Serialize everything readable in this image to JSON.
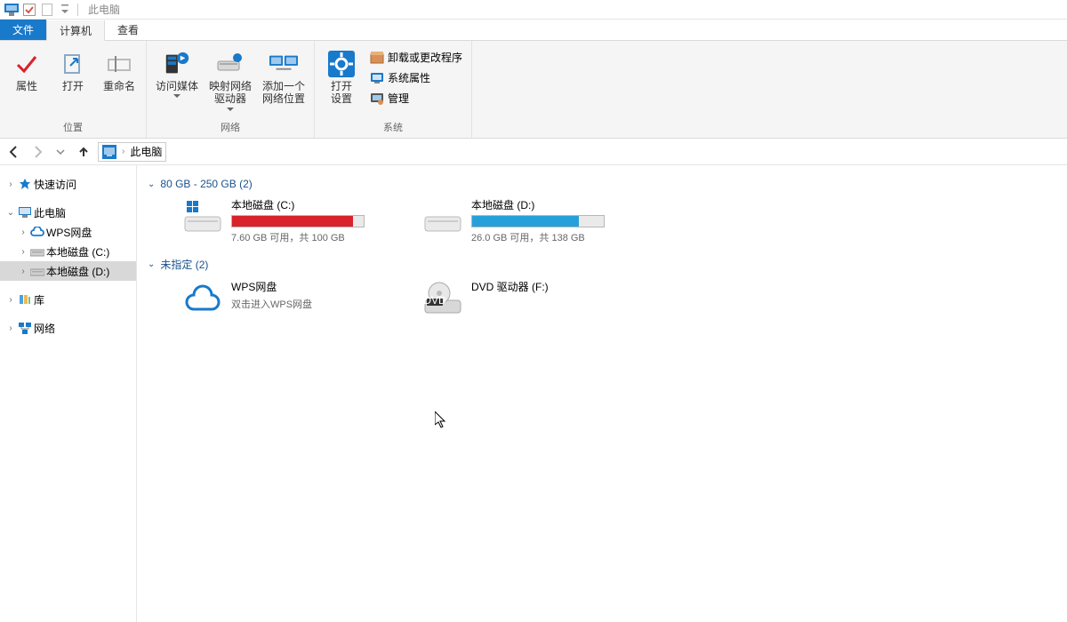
{
  "title_bar": {
    "title": "此电脑"
  },
  "tabs": {
    "file": "文件",
    "computer": "计算机",
    "view": "查看"
  },
  "ribbon": {
    "group_location": {
      "label": "位置",
      "properties": "属性",
      "open": "打开",
      "rename": "重命名"
    },
    "group_network": {
      "label": "网络",
      "access_media": "访问媒体",
      "map_drive": "映射网络\n驱动器",
      "add_location": "添加一个\n网络位置"
    },
    "group_system": {
      "label": "系统",
      "open_settings": "打开\n设置",
      "uninstall": "卸载或更改程序",
      "sys_props": "系统属性",
      "manage": "管理"
    }
  },
  "nav": {
    "breadcrumb": "此电脑"
  },
  "sidebar": {
    "quick_access": "快速访问",
    "this_pc": "此电脑",
    "wps": "WPS网盘",
    "disk_c": "本地磁盘 (C:)",
    "disk_d": "本地磁盘 (D:)",
    "libraries": "库",
    "network": "网络"
  },
  "content": {
    "group1_header": "80 GB - 250 GB (2)",
    "group2_header": "未指定 (2)",
    "drives": [
      {
        "name": "本地磁盘 (C:)",
        "sub": "7.60 GB 可用，共 100 GB",
        "fill_pct": 92,
        "fill_color": "#d9222a"
      },
      {
        "name": "本地磁盘 (D:)",
        "sub": "26.0 GB 可用，共 138 GB",
        "fill_pct": 81,
        "fill_color": "#26a0da"
      }
    ],
    "others": [
      {
        "name": "WPS网盘",
        "sub": "双击进入WPS网盘"
      },
      {
        "name": "DVD 驱动器 (F:)",
        "sub": ""
      }
    ]
  }
}
